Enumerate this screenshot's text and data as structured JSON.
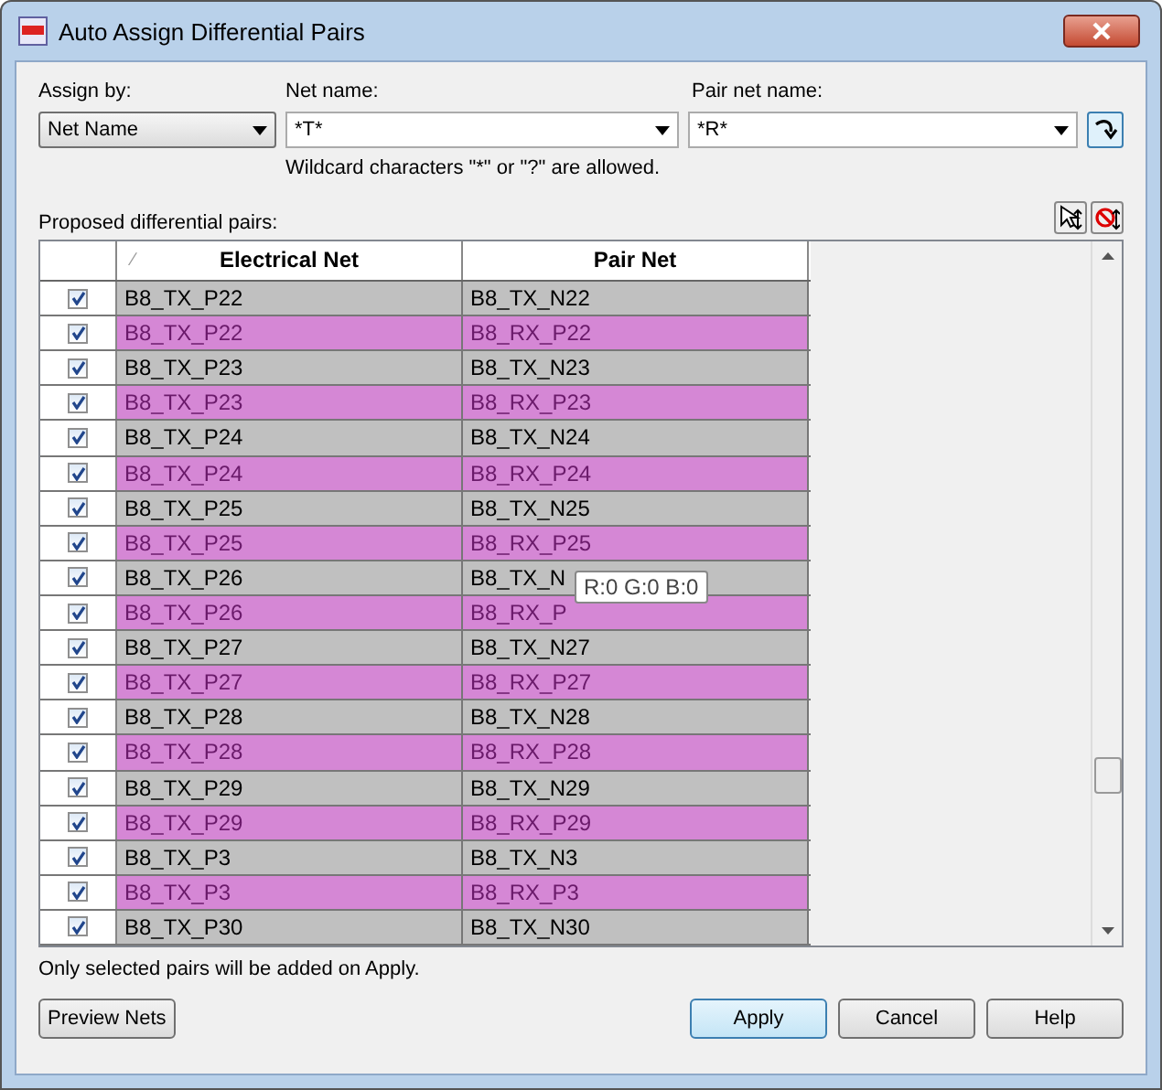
{
  "window": {
    "title": "Auto Assign Differential Pairs"
  },
  "assign_by": {
    "label": "Assign by:",
    "value": "Net Name"
  },
  "net_name": {
    "label": "Net name:",
    "value": "*T*"
  },
  "pair_net_name": {
    "label": "Pair net name:",
    "value": "*R*"
  },
  "hint": "Wildcard characters \"*\" or \"?\" are allowed.",
  "proposed_label": "Proposed differential pairs:",
  "table": {
    "columns": [
      "Electrical Net",
      "Pair Net"
    ],
    "sort_mark": "∕",
    "rows": [
      {
        "checked": true,
        "highlighted": false,
        "net": "B8_TX_P22",
        "pair": "B8_TX_N22"
      },
      {
        "checked": true,
        "highlighted": true,
        "net": "B8_TX_P22",
        "pair": "B8_RX_P22"
      },
      {
        "checked": true,
        "highlighted": false,
        "net": "B8_TX_P23",
        "pair": "B8_TX_N23"
      },
      {
        "checked": true,
        "highlighted": true,
        "net": "B8_TX_P23",
        "pair": "B8_RX_P23"
      },
      {
        "checked": true,
        "highlighted": false,
        "net": "B8_TX_P24",
        "pair": "B8_TX_N24"
      },
      {
        "checked": true,
        "highlighted": true,
        "net": "B8_TX_P24",
        "pair": "B8_RX_P24"
      },
      {
        "checked": true,
        "highlighted": false,
        "net": "B8_TX_P25",
        "pair": "B8_TX_N25"
      },
      {
        "checked": true,
        "highlighted": true,
        "net": "B8_TX_P25",
        "pair": "B8_RX_P25"
      },
      {
        "checked": true,
        "highlighted": false,
        "net": "B8_TX_P26",
        "pair": "B8_TX_N"
      },
      {
        "checked": true,
        "highlighted": true,
        "net": "B8_TX_P26",
        "pair": "B8_RX_P"
      },
      {
        "checked": true,
        "highlighted": false,
        "net": "B8_TX_P27",
        "pair": "B8_TX_N27"
      },
      {
        "checked": true,
        "highlighted": true,
        "net": "B8_TX_P27",
        "pair": "B8_RX_P27"
      },
      {
        "checked": true,
        "highlighted": false,
        "net": "B8_TX_P28",
        "pair": "B8_TX_N28"
      },
      {
        "checked": true,
        "highlighted": true,
        "net": "B8_TX_P28",
        "pair": "B8_RX_P28"
      },
      {
        "checked": true,
        "highlighted": false,
        "net": "B8_TX_P29",
        "pair": "B8_TX_N29"
      },
      {
        "checked": true,
        "highlighted": true,
        "net": "B8_TX_P29",
        "pair": "B8_RX_P29"
      },
      {
        "checked": true,
        "highlighted": false,
        "net": "B8_TX_P3",
        "pair": "B8_TX_N3"
      },
      {
        "checked": true,
        "highlighted": true,
        "net": "B8_TX_P3",
        "pair": "B8_RX_P3"
      },
      {
        "checked": true,
        "highlighted": false,
        "net": "B8_TX_P30",
        "pair": "B8_TX_N30"
      }
    ]
  },
  "tooltip": "R:0 G:0 B:0",
  "footer_note": "Only selected pairs will be added on Apply.",
  "buttons": [
    {
      "label": "Preview Nets",
      "kind": "left"
    },
    {
      "label": "Apply",
      "kind": "default"
    },
    {
      "label": "Cancel",
      "kind": "normal"
    },
    {
      "label": "Help",
      "kind": "normal"
    }
  ]
}
